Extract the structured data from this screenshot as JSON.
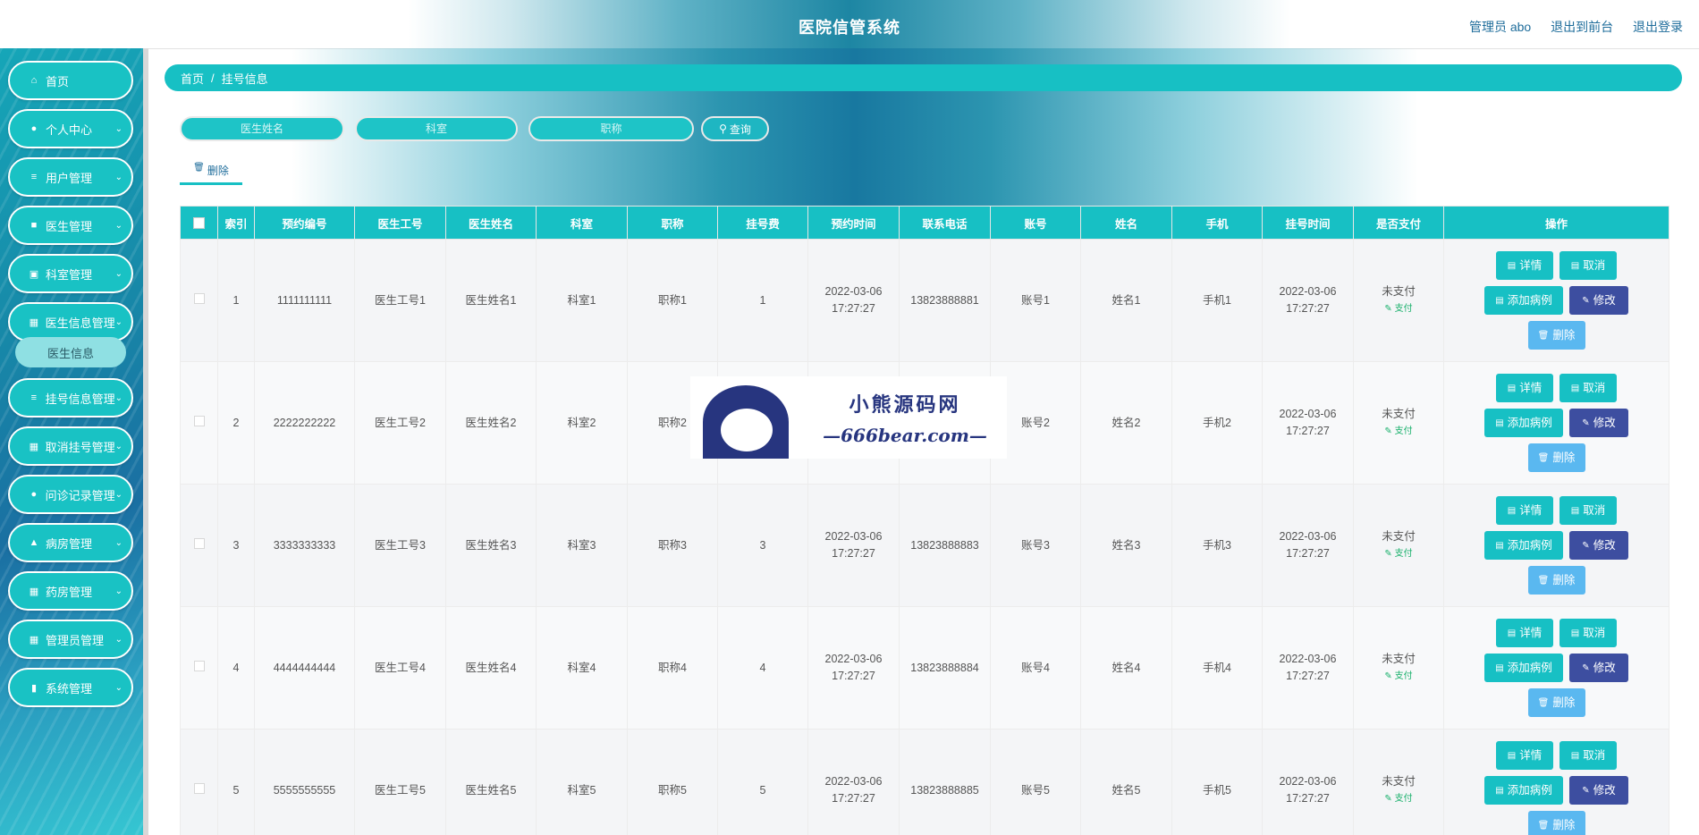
{
  "header": {
    "title": "医院信管系统",
    "links": [
      "管理员 abo",
      "退出到前台",
      "退出登录"
    ]
  },
  "sidebar": {
    "items": [
      {
        "label": "首页",
        "icon": "home-icon",
        "glyph": "⌂",
        "has_arrow": false
      },
      {
        "label": "个人中心",
        "icon": "user-icon",
        "glyph": "●",
        "has_arrow": true
      },
      {
        "label": "用户管理",
        "icon": "sliders-icon",
        "glyph": "≡",
        "has_arrow": true
      },
      {
        "label": "医生管理",
        "icon": "doc-icon",
        "glyph": "■",
        "has_arrow": true
      },
      {
        "label": "科室管理",
        "icon": "briefcase-icon",
        "glyph": "▣",
        "has_arrow": true
      },
      {
        "label": "医生信息管理",
        "icon": "grid-icon",
        "glyph": "▦",
        "has_arrow": true
      },
      {
        "label": "挂号信息管理",
        "icon": "list-icon",
        "glyph": "≡",
        "has_arrow": true
      },
      {
        "label": "取消挂号管理",
        "icon": "grid-icon",
        "glyph": "▦",
        "has_arrow": true
      },
      {
        "label": "问诊记录管理",
        "icon": "pin-icon",
        "glyph": "●",
        "has_arrow": true
      },
      {
        "label": "病房管理",
        "icon": "thumb-icon",
        "glyph": "▲",
        "has_arrow": true
      },
      {
        "label": "药房管理",
        "icon": "grid-icon",
        "glyph": "▦",
        "has_arrow": true
      },
      {
        "label": "管理员管理",
        "icon": "grid-icon",
        "glyph": "▦",
        "has_arrow": true
      },
      {
        "label": "系统管理",
        "icon": "chart-icon",
        "glyph": "▮",
        "has_arrow": true
      }
    ],
    "submenu": {
      "label": "医生信息"
    }
  },
  "breadcrumb": {
    "home": "首页",
    "sep": "/",
    "current": "挂号信息"
  },
  "search": {
    "doctor_name_placeholder": "医生姓名",
    "department_placeholder": "科室",
    "title_placeholder": "职称",
    "query_label": "查询"
  },
  "toolbar": {
    "delete_label": "删除"
  },
  "table": {
    "headers": [
      "索引",
      "预约编号",
      "医生工号",
      "医生姓名",
      "科室",
      "职称",
      "挂号费",
      "预约时间",
      "联系电话",
      "账号",
      "姓名",
      "手机",
      "挂号时间",
      "是否支付",
      "操作"
    ],
    "rows": [
      {
        "index": "1",
        "appt_no": "1111111111",
        "doc_id": "医生工号1",
        "doc_name": "医生姓名1",
        "dept": "科室1",
        "title": "职称1",
        "fee": "1",
        "appt_time": "2022-03-06 17:27:27",
        "phone": "13823888881",
        "account": "账号1",
        "name": "姓名1",
        "mobile": "手机1",
        "reg_time": "2022-03-06 17:27:27",
        "paid": "未支付",
        "pay": "支付"
      },
      {
        "index": "2",
        "appt_no": "2222222222",
        "doc_id": "医生工号2",
        "doc_name": "医生姓名2",
        "dept": "科室2",
        "title": "职称2",
        "fee": "",
        "appt_time": "",
        "phone": "",
        "account": "账号2",
        "name": "姓名2",
        "mobile": "手机2",
        "reg_time": "2022-03-06 17:27:27",
        "paid": "未支付",
        "pay": "支付"
      },
      {
        "index": "3",
        "appt_no": "3333333333",
        "doc_id": "医生工号3",
        "doc_name": "医生姓名3",
        "dept": "科室3",
        "title": "职称3",
        "fee": "3",
        "appt_time": "2022-03-06 17:27:27",
        "phone": "13823888883",
        "account": "账号3",
        "name": "姓名3",
        "mobile": "手机3",
        "reg_time": "2022-03-06 17:27:27",
        "paid": "未支付",
        "pay": "支付"
      },
      {
        "index": "4",
        "appt_no": "4444444444",
        "doc_id": "医生工号4",
        "doc_name": "医生姓名4",
        "dept": "科室4",
        "title": "职称4",
        "fee": "4",
        "appt_time": "2022-03-06 17:27:27",
        "phone": "13823888884",
        "account": "账号4",
        "name": "姓名4",
        "mobile": "手机4",
        "reg_time": "2022-03-06 17:27:27",
        "paid": "未支付",
        "pay": "支付"
      },
      {
        "index": "5",
        "appt_no": "5555555555",
        "doc_id": "医生工号5",
        "doc_name": "医生姓名5",
        "dept": "科室5",
        "title": "职称5",
        "fee": "5",
        "appt_time": "2022-03-06 17:27:27",
        "phone": "13823888885",
        "account": "账号5",
        "name": "姓名5",
        "mobile": "手机5",
        "reg_time": "2022-03-06 17:27:27",
        "paid": "未支付",
        "pay": "支付"
      }
    ],
    "actions": {
      "detail": "详情",
      "cancel": "取消",
      "add_record": "添加病例",
      "edit": "修改",
      "delete": "删除"
    }
  },
  "watermark": {
    "line1": "小熊源码网",
    "line2": "—666bear.com—"
  },
  "colors": {
    "accent": "#17c0c4",
    "indigo": "#3d4ea0",
    "light_blue": "#5ab8f0",
    "link": "#1f6d9b"
  }
}
